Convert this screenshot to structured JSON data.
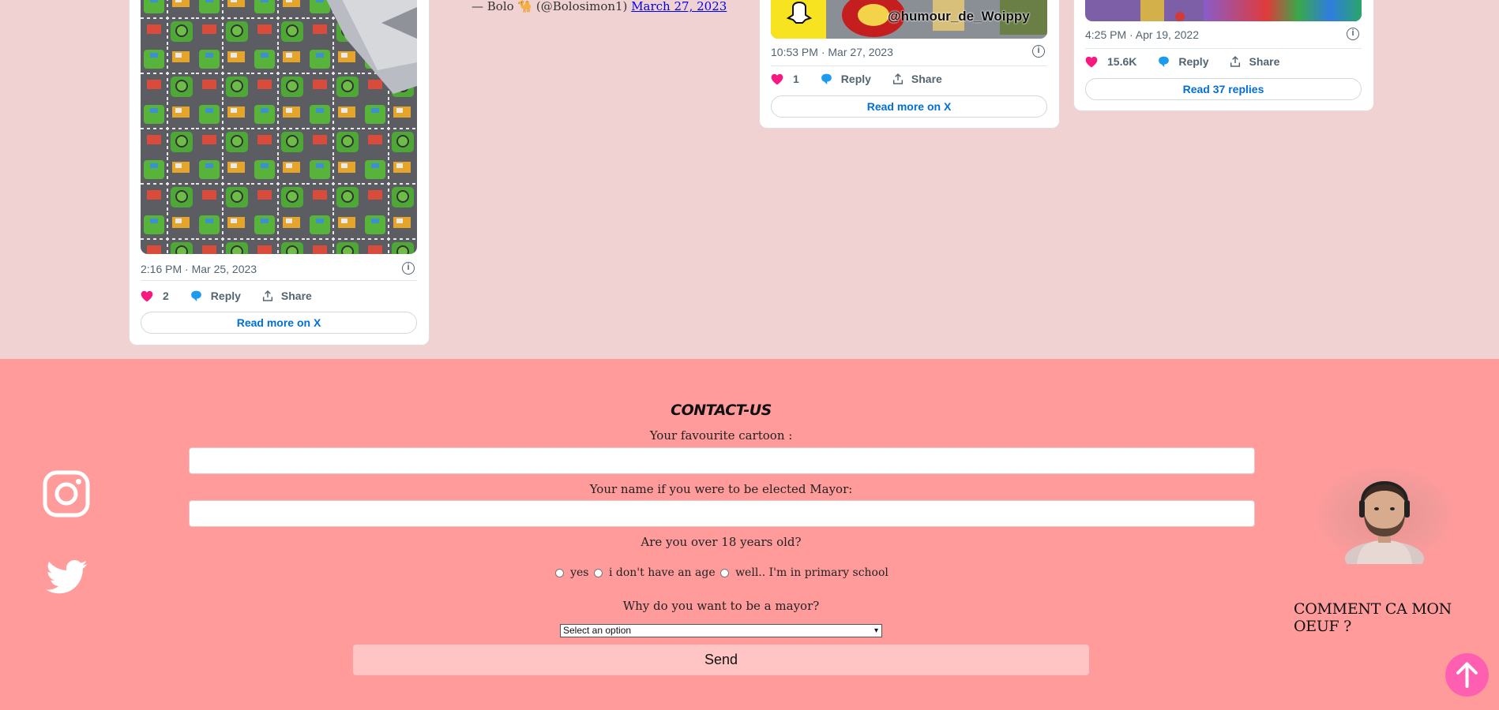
{
  "tweets": [
    {
      "timestamp": "2:16 PM · Mar 25, 2023",
      "likes": "2",
      "reply_label": "Reply",
      "share_label": "Share",
      "read_label": "Read more on X"
    },
    {
      "image_overlay_text": "@humour_de_Woippy",
      "timestamp": "10:53 PM · Mar 27, 2023",
      "likes": "1",
      "reply_label": "Reply",
      "share_label": "Share",
      "read_label": "Read more on X"
    },
    {
      "timestamp": "4:25 PM · Apr 19, 2022",
      "likes": "15.6K",
      "reply_label": "Reply",
      "share_label": "Share",
      "read_label": "Read 37 replies"
    }
  ],
  "blockquote": {
    "author": "— Bolo 🐪 (@Bolosimon1)",
    "date_link": "March 27, 2023"
  },
  "contact": {
    "title": "CONTACT-US",
    "cartoon_label": "Your favourite cartoon :",
    "cartoon_value": "",
    "mayor_name_label": "Your name if you were to be elected Mayor:",
    "mayor_name_value": "",
    "age_question": "Are you over 18 years old?",
    "age_options": [
      "yes",
      "i don't have an age",
      "well.. I'm in primary school"
    ],
    "why_label": "Why do you want to be a mayor?",
    "select_value": "Select an option",
    "send_label": "Send"
  },
  "social": {
    "icons": [
      "instagram-icon",
      "twitter-icon"
    ]
  },
  "profile": {
    "caption": "COMMENT CA MON OEUF ?"
  },
  "colors": {
    "page_bg": "#f0d2d2",
    "footer_bg": "#ff9b9b",
    "send_bg": "#ffc5c5",
    "scroll_top_bg": "#ff5fb0",
    "heart": "#f91880",
    "link_blue": "#006fd6"
  }
}
